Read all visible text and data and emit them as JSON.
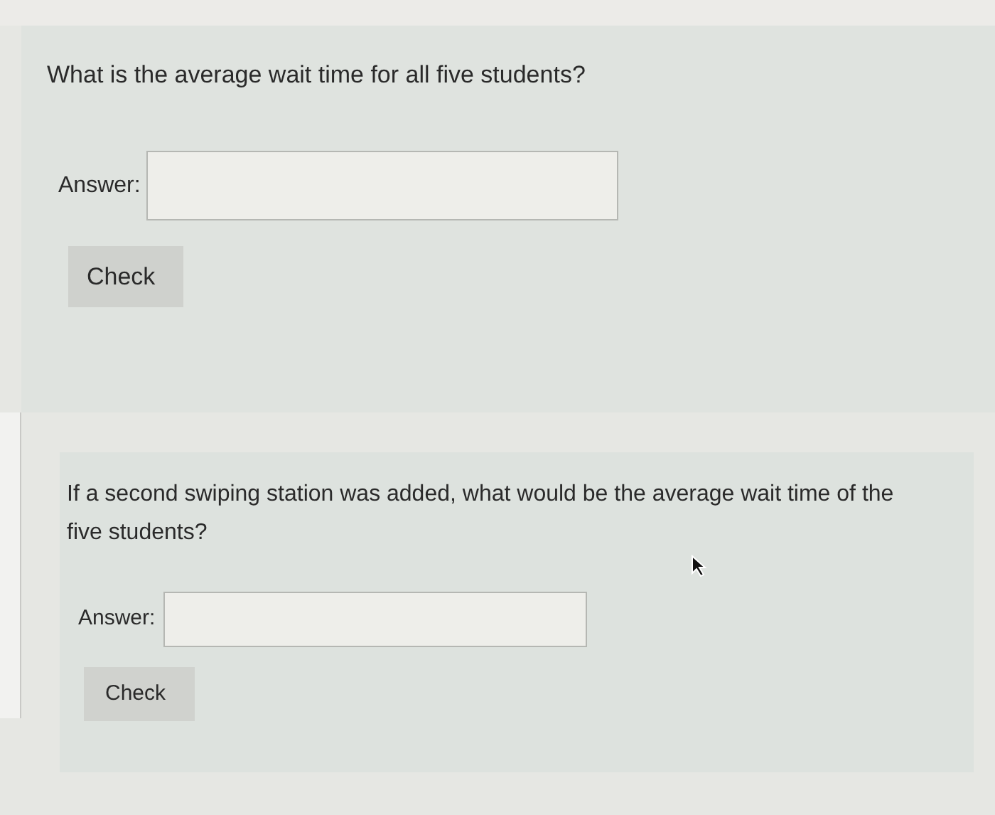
{
  "questions": [
    {
      "prompt": "What is the average wait time for all five students?",
      "answer_label": "Answer:",
      "button": "Check"
    },
    {
      "prompt": "If a second swiping station was added, what would be the average wait time of the five students?",
      "answer_label": "Answer:",
      "button": "Check"
    }
  ]
}
